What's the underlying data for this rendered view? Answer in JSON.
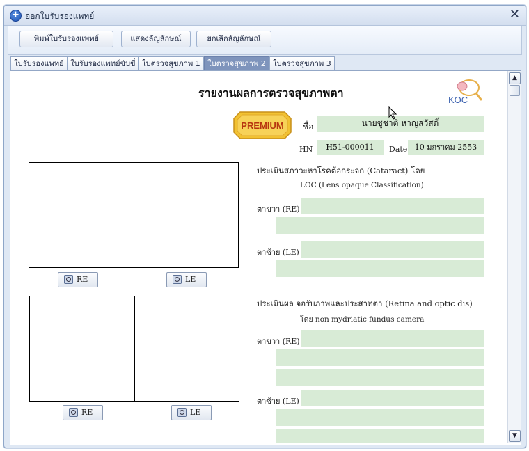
{
  "window": {
    "title": "ออกใบรับรองแพทย์",
    "close_glyph": "✕"
  },
  "toolbar": {
    "print_label": "พิมพ์ใบรับรองแพทย์",
    "show_sign_label": "แสดงลัญลักษณ์",
    "cancel_sign_label": "ยกเลิกลัญลักษณ์"
  },
  "tabs": [
    {
      "label": "ใบรับรองแพทย์"
    },
    {
      "label": "ใบรับรองแพทย์ขับขี่"
    },
    {
      "label": "ใบตรวจสุขภาพ 1"
    },
    {
      "label": "ใบตรวจสุขภาพ 2"
    },
    {
      "label": "ใบตรวจสุขภาพ 3"
    }
  ],
  "active_tab_index": 3,
  "report": {
    "title": "รายงานผลการตรวจสุขภาพตา",
    "premium_badge": "PREMIUM",
    "logo_text": "KOC",
    "name_label": "ชื่อ",
    "name_value": "นายชูชาติ หาญสวัสดิ์",
    "hn_label": "HN",
    "hn_value": "H51-000011",
    "date_label": "Date",
    "date_value": "10 มกราคม 2553",
    "cataract": {
      "heading": "ประเมินสภาวะหาโรคต้อกระจก (Cataract) โดย",
      "subheading": "LOC (Lens opaque Classification)",
      "re_label": "ตาขวา (RE)",
      "le_label": "ตาซ้าย (LE)"
    },
    "retina": {
      "heading": "ประเมินผล จอรับภาพและประสาทตา (Retina and optic dis)",
      "subheading": "โดย  non mydriatic fundus camera",
      "re_label": "ตาขวา (RE)",
      "le_label": "ตาซ้าย (LE)"
    },
    "image_buttons": {
      "re": "RE",
      "le": "LE"
    }
  },
  "colors": {
    "field_bg": "#d8ebd6",
    "active_tab": "#7e94bc",
    "premium_gold": "#f2c232"
  }
}
